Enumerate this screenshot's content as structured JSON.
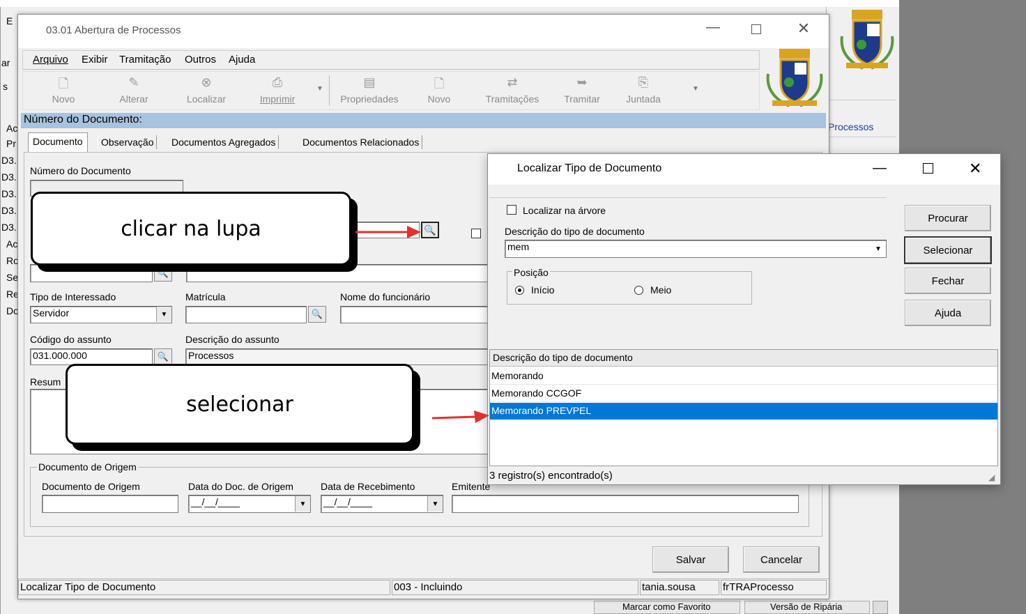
{
  "background_window": {
    "left_letters": [
      "E",
      "ar",
      "s",
      "Ac",
      "Pr",
      "D3.",
      "D3.",
      "D3.",
      "D3.",
      "D3.",
      "Ac",
      "Ro",
      "Se",
      "Re",
      "Do"
    ],
    "right_link": "Processos",
    "bottom_buttons": [
      "Marcar como Favorito",
      "Versão de Ripária"
    ]
  },
  "main_window": {
    "title": "03.01 Abertura de Processos",
    "menu": [
      "Arquivo",
      "Exibir",
      "Tramitação",
      "Outros",
      "Ajuda"
    ],
    "toolbar": [
      {
        "label": "Novo",
        "icon": "new-doc-icon"
      },
      {
        "label": "Alterar",
        "icon": "edit-icon"
      },
      {
        "label": "Localizar",
        "icon": "binoculars-icon"
      },
      {
        "label": "Imprimir",
        "icon": "printer-icon"
      },
      {
        "label": "Propriedades",
        "icon": "properties-icon"
      },
      {
        "label": "Novo",
        "icon": "new-doc-icon"
      },
      {
        "label": "Tramitações",
        "icon": "tramitacoes-icon"
      },
      {
        "label": "Tramitar",
        "icon": "tramitar-icon"
      },
      {
        "label": "Juntada",
        "icon": "juntada-icon"
      }
    ],
    "header_label": "Número do Documento:",
    "tabs": [
      "Documento",
      "Observação",
      "Documentos Agregados",
      "Documentos Relacionados"
    ],
    "fields": {
      "numero_documento_label": "Número do Documento",
      "tipo_interessado_label": "Tipo de Interessado",
      "tipo_interessado_value": "Servidor",
      "matricula_label": "Matrícula",
      "nome_funcionario_label": "Nome do funcionário",
      "codigo_assunto_label": "Código do assunto",
      "codigo_assunto_value": "031.000.000",
      "descricao_assunto_label": "Descrição do assunto",
      "descricao_assunto_value": "Processos",
      "resumo_label": "Resum"
    },
    "origem_group": {
      "title": "Documento de Origem",
      "doc_origem_label": "Documento de Origem",
      "data_doc_label": "Data do Doc. de Origem",
      "data_doc_value": "__/__/____",
      "data_receb_label": "Data de Recebimento",
      "data_receb_value": "__/__/____",
      "emitente_label": "Emitente"
    },
    "buttons": {
      "salvar": "Salvar",
      "cancelar": "Cancelar"
    },
    "status_bar": [
      "Localizar Tipo de Documento",
      "003 - Incluindo",
      "tania.sousa",
      "frTRAProcesso"
    ]
  },
  "dialog": {
    "title": "Localizar Tipo de Documento",
    "localizar_arvore_label": "Localizar na árvore",
    "descricao_label": "Descrição do tipo de documento",
    "descricao_value": "mem",
    "posicao_label": "Posição",
    "radio_inicio": "Início",
    "radio_meio": "Meio",
    "buttons": {
      "procurar": "Procurar",
      "selecionar": "Selecionar",
      "fechar": "Fechar",
      "ajuda": "Ajuda"
    },
    "grid_header": "Descrição do tipo de documento",
    "grid_rows": [
      "Memorando",
      "Memorando CCGOF",
      "Memorando PREVPEL"
    ],
    "selected_row": "Memorando PREVPEL",
    "status": "3 registro(s) encontrado(s)"
  },
  "annotations": {
    "callout1": "clicar na lupa",
    "callout2": "selecionar"
  },
  "colors": {
    "selection": "#0078d7",
    "header_bar": "#a6c3df",
    "arrow": "#e2312b",
    "gray_panel": "#7f7f7f"
  }
}
